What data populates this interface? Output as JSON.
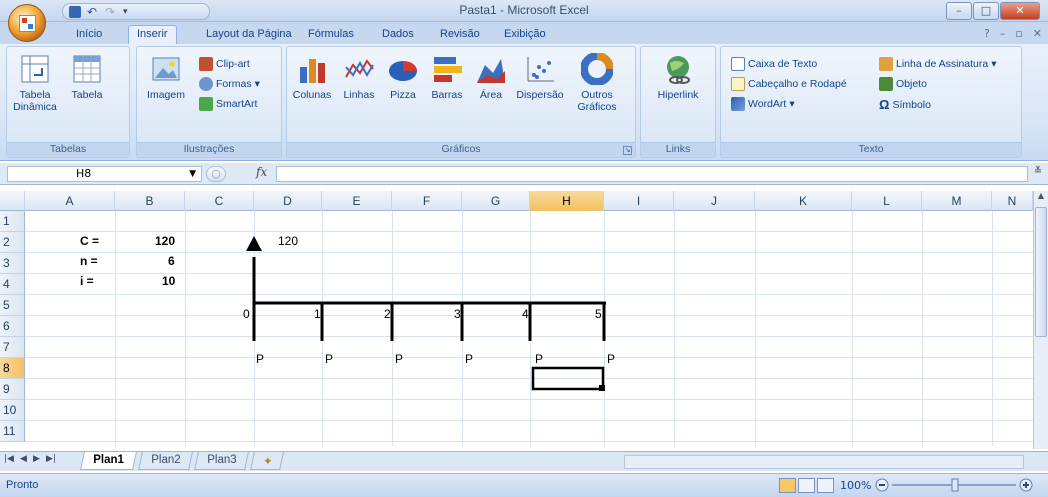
{
  "window": {
    "title": "Pasta1 - Microsoft Excel"
  },
  "tabs": [
    "Início",
    "Inserir",
    "Layout da Página",
    "Fórmulas",
    "Dados",
    "Revisão",
    "Exibição"
  ],
  "ribbon": {
    "tabelas": {
      "label": "Tabelas",
      "buttons": [
        "Tabela\nDinâmica",
        "Tabela"
      ]
    },
    "ilustracoes": {
      "label": "Ilustrações",
      "imagem": "Imagem",
      "clipart": "Clip-art",
      "formas": "Formas",
      "smartart": "SmartArt"
    },
    "graficos": {
      "label": "Gráficos",
      "buttons": [
        "Colunas",
        "Linhas",
        "Pizza",
        "Barras",
        "Área",
        "Dispersão",
        "Outros\nGráficos"
      ]
    },
    "links": {
      "label": "Links",
      "hiperlink": "Hiperlink"
    },
    "texto": {
      "label": "Texto",
      "caixa": "Caixa de Texto",
      "cabecalho": "Cabeçalho e Rodapé",
      "wordart": "WordArt",
      "linha": "Linha de Assinatura",
      "objeto": "Objeto",
      "simbolo": "Símbolo"
    }
  },
  "formula": {
    "namebox": "H8",
    "fx": "fx",
    "value": ""
  },
  "columns": [
    "A",
    "B",
    "C",
    "D",
    "E",
    "F",
    "G",
    "H",
    "I",
    "J",
    "K",
    "L",
    "M",
    "N"
  ],
  "rows": [
    "1",
    "2",
    "3",
    "4",
    "5",
    "6",
    "7",
    "8",
    "9",
    "10",
    "11"
  ],
  "cells": {
    "A2": "C =",
    "B2": "120",
    "A3": "n =",
    "B3": "6",
    "A4": "i =",
    "B4": "10",
    "D2": "120",
    "t0": "0",
    "t1": "1",
    "t2": "2",
    "t3": "3",
    "t4": "4",
    "t5": "5",
    "P": "P"
  },
  "sheets": [
    "Plan1",
    "Plan2",
    "Plan3"
  ],
  "status": {
    "text": "Pronto",
    "zoom": "100%"
  }
}
